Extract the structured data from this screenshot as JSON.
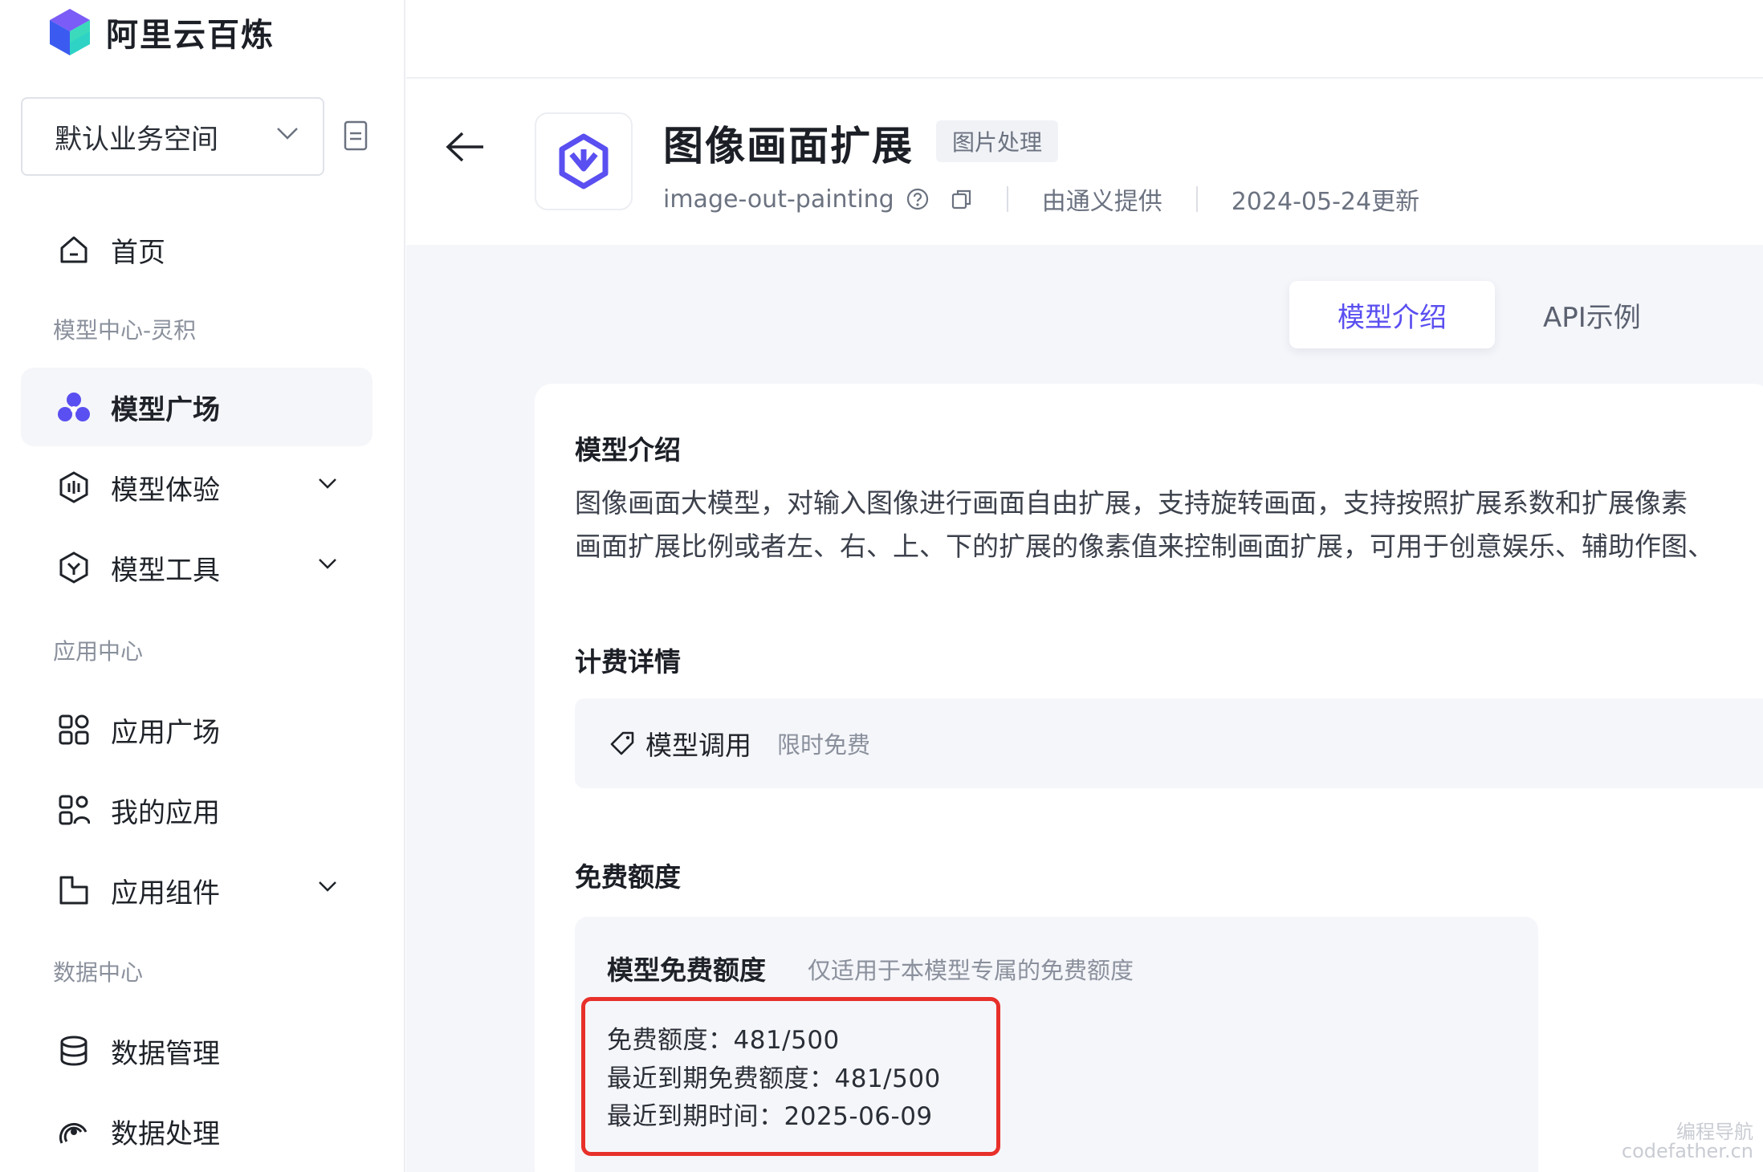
{
  "brand": {
    "name": "阿里云百炼"
  },
  "workspace": {
    "label": "默认业务空间"
  },
  "sidebar": {
    "home": "首页",
    "section_model": "模型中心-灵积",
    "model_square": "模型广场",
    "model_experience": "模型体验",
    "model_tools": "模型工具",
    "section_app": "应用中心",
    "app_square": "应用广场",
    "my_apps": "我的应用",
    "app_components": "应用组件",
    "section_data": "数据中心",
    "data_management": "数据管理",
    "data_processing": "数据处理"
  },
  "model": {
    "title": "图像画面扩展",
    "tag": "图片处理",
    "id": "image-out-painting",
    "provider": "由通义提供",
    "updated": "2024-05-24更新"
  },
  "tabs": {
    "intro": "模型介绍",
    "api": "API示例"
  },
  "intro": {
    "heading": "模型介绍",
    "line1": "图像画面大模型，对输入图像进行画面自由扩展，支持旋转画面，支持按照扩展系数和扩展像素",
    "line2": "画面扩展比例或者左、右、上、下的扩展的像素值来控制画面扩展，可用于创意娱乐、辅助作图、"
  },
  "billing": {
    "heading": "计费详情",
    "item_name": "模型调用",
    "item_value": "限时免费"
  },
  "quota": {
    "heading": "免费额度",
    "box_title": "模型免费额度",
    "box_subtitle": "仅适用于本模型专属的免费额度",
    "line1": "免费额度：481/500",
    "line2": "最近到期免费额度：481/500",
    "line3": "最近到期时间：2025-06-09"
  },
  "watermark": {
    "line1": "编程导航",
    "line2": "codefather.cn"
  },
  "colors": {
    "accent": "#5a4ff0",
    "highlight": "#e8302a"
  }
}
